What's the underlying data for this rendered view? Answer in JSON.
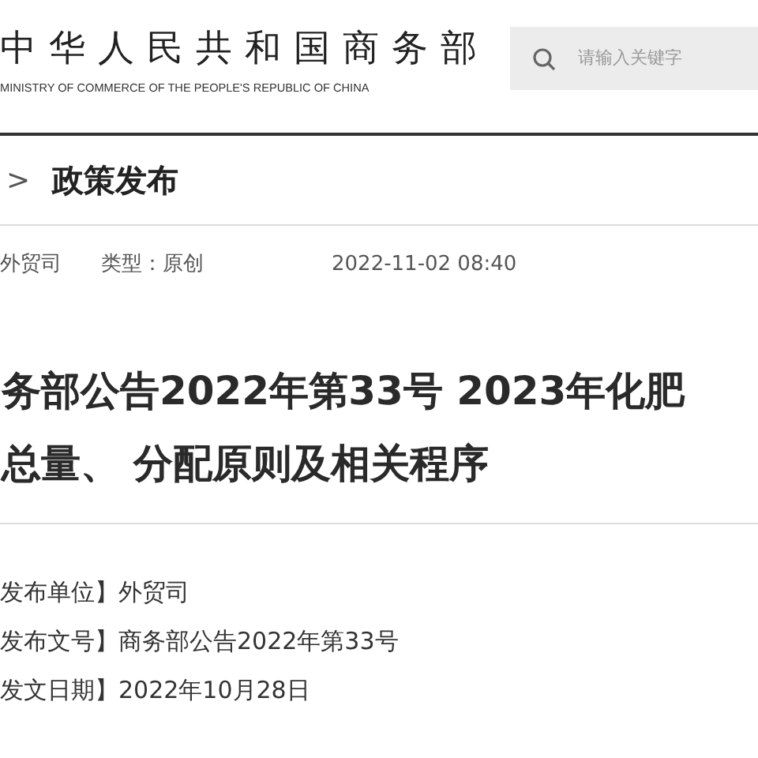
{
  "header": {
    "logo_title": "中华人民共和国商务部",
    "logo_subtitle": "MINISTRY OF COMMERCE OF THE PEOPLE'S REPUBLIC OF CHINA",
    "search": {
      "placeholder": "请输入关键字"
    }
  },
  "breadcrumb": {
    "separator": ">",
    "section": "政策发布"
  },
  "meta": {
    "department": "外贸司",
    "type": "类型：原创",
    "datetime": "2022-11-02 08:40"
  },
  "article_title": [
    "务部公告2022年第33号 2023年化肥",
    "总量、 分配原则及相关程序"
  ],
  "fields": [
    {
      "text": "发布单位】外贸司"
    },
    {
      "text": "发布文号】商务部公告2022年第33号"
    },
    {
      "text": "发文日期】2022年10月28日"
    }
  ]
}
